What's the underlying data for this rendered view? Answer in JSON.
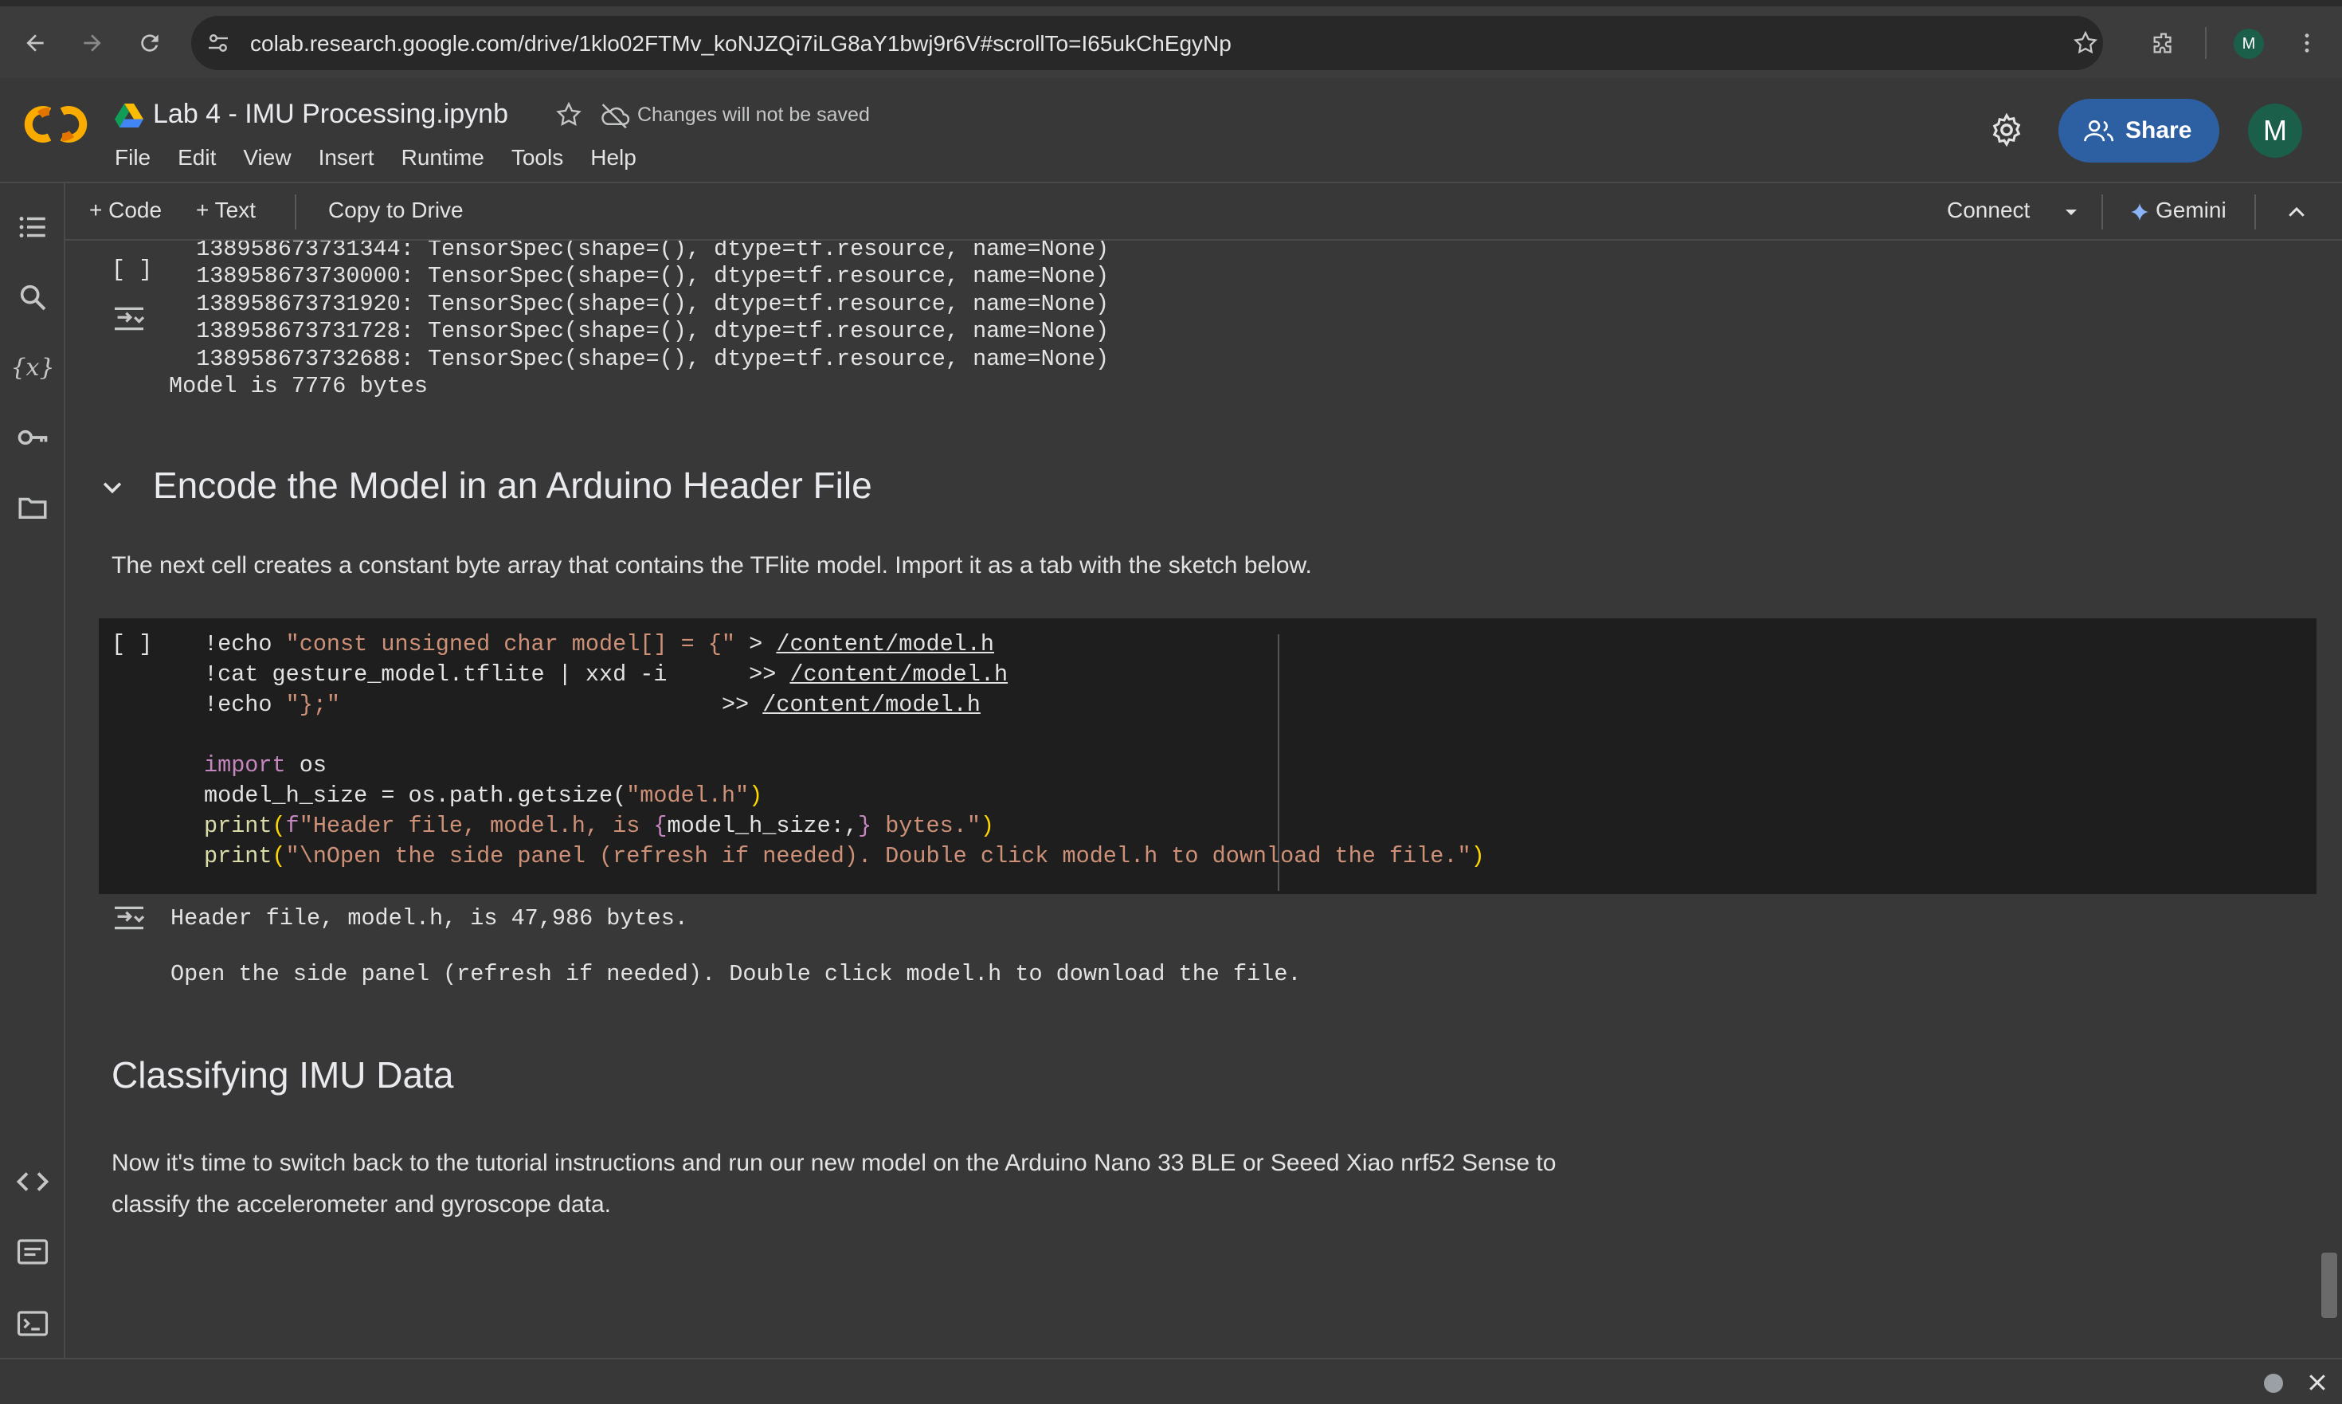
{
  "browser": {
    "url": "colab.research.google.com/drive/1klo02FTMv_koNJZQi7iLG8aY1bwj9r6V#scrollTo=I65ukChEgyNp",
    "profile_initial": "M"
  },
  "header": {
    "title": "Lab 4 - IMU Processing.ipynb",
    "save_status": "Changes will not be saved",
    "menu": [
      "File",
      "Edit",
      "View",
      "Insert",
      "Runtime",
      "Tools",
      "Help"
    ],
    "share_label": "Share",
    "avatar_initial": "M"
  },
  "toolbar": {
    "add_code": "+ Code",
    "add_text": "+ Text",
    "copy_to_drive": "Copy to Drive",
    "connect": "Connect",
    "gemini": "Gemini"
  },
  "prev_cell": {
    "bracket": "[ ]",
    "output_lines": [
      "  138958673731344: TensorSpec(shape=(), dtype=tf.resource, name=None)",
      "  138958673730000: TensorSpec(shape=(), dtype=tf.resource, name=None)",
      "  138958673731920: TensorSpec(shape=(), dtype=tf.resource, name=None)",
      "  138958673731728: TensorSpec(shape=(), dtype=tf.resource, name=None)",
      "  138958673732688: TensorSpec(shape=(), dtype=tf.resource, name=None)",
      "Model is 7776 bytes"
    ]
  },
  "section1": {
    "heading": "Encode the Model in an Arduino Header File",
    "text": "The next cell creates a constant byte array that contains the TFlite model. Import it as a tab with the sketch below."
  },
  "code_cell": {
    "bracket": "[ ]",
    "l1_a": "!echo ",
    "l1_str": "\"const unsigned char model[] = {\"",
    "l1_b": " > ",
    "l1_link": "/content/model.h",
    "l2_a": "!cat gesture_model.tflite | xxd -i      >> ",
    "l2_link": "/content/model.h",
    "l3_a": "!echo ",
    "l3_str": "\"};\"",
    "l3_b": "                            >> ",
    "l3_link": "/content/model.h",
    "l5_kw": "import",
    "l5_b": " os",
    "l6_a": "model_h_size = os.path.getsize(",
    "l6_str": "\"model.h\"",
    "l6_b": ")",
    "l7_fn": "print",
    "l7_p1": "(",
    "l7_f": "f",
    "l7_str1": "\"Header file, model.h, is ",
    "l7_br1": "{",
    "l7_var": "model_h_size:,",
    "l7_br2": "}",
    "l7_str2": " bytes.\"",
    "l7_p2": ")",
    "l8_fn": "print",
    "l8_p1": "(",
    "l8_str": "\"\\nOpen the side panel (refresh if needed). Double click model.h to download the file.\"",
    "l8_p2": ")"
  },
  "code_output": {
    "line1": "Header file, model.h, is 47,986 bytes.",
    "line2": "Open the side panel (refresh if needed). Double click model.h to download the file."
  },
  "section2": {
    "heading": "Classifying IMU Data",
    "text_line1": "Now it's time to switch back to the tutorial instructions and run our new model on the Arduino Nano 33 BLE or Seeed Xiao nrf52 Sense to",
    "text_line2": "classify the accelerometer and gyroscope data."
  },
  "colors": {
    "accent": "#2d5fa3",
    "code_bg": "#1e1e1e",
    "string": "#ce9178",
    "keyword": "#c586c0"
  }
}
